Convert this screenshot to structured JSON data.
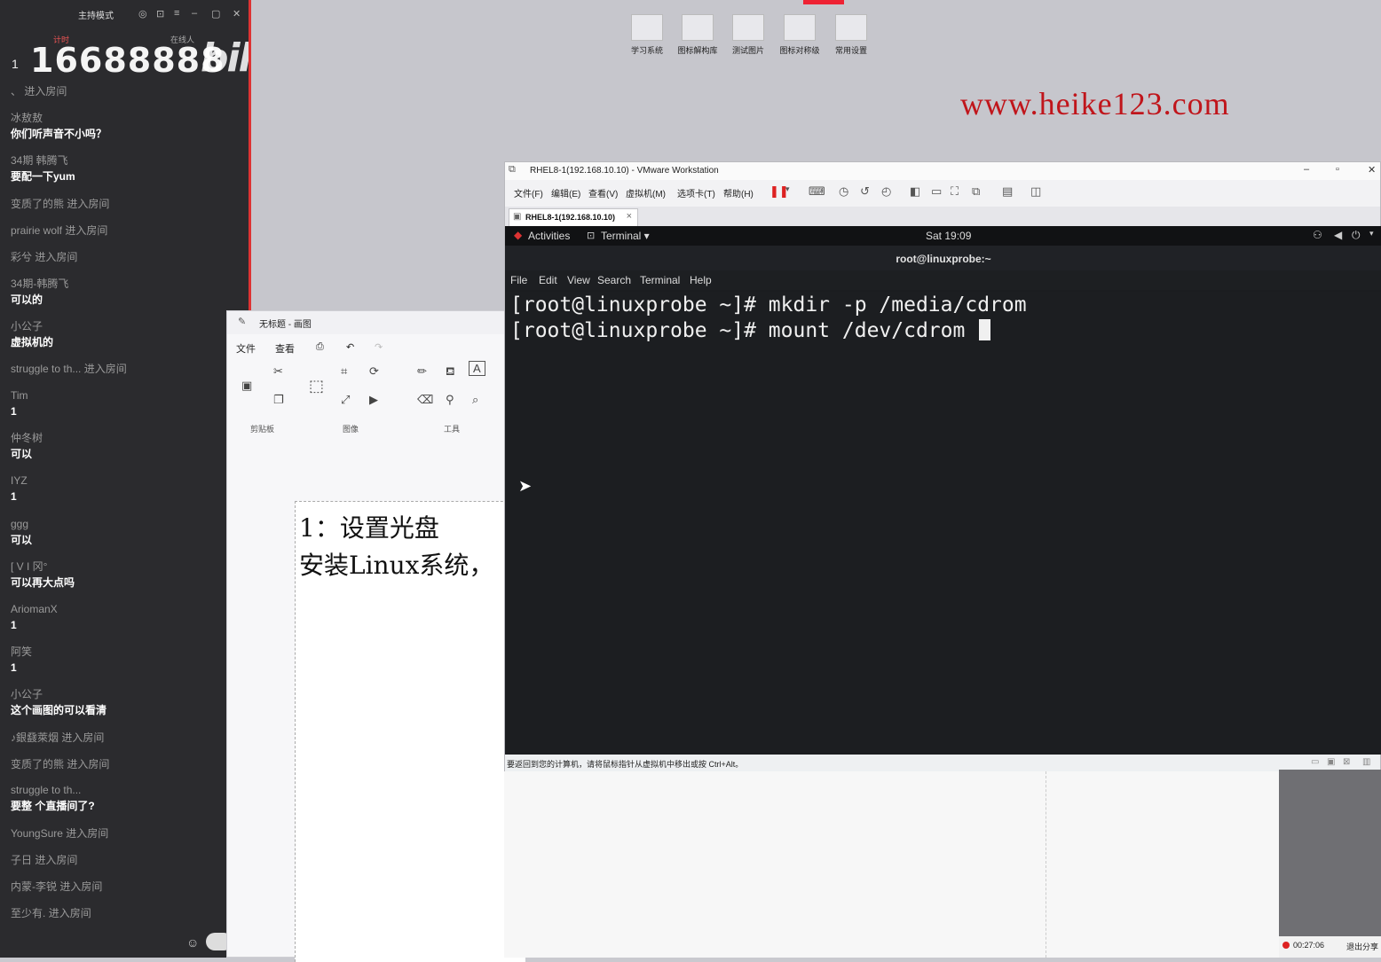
{
  "chat": {
    "mode_label": "主持模式",
    "top_controls": [
      "◎",
      "⊡",
      "≡",
      "–",
      "▢",
      "✕"
    ],
    "head_left": "计时",
    "head_right": "在线人",
    "rank_index": "1",
    "room_number": "16688888",
    "brand": "bilibili",
    "messages": [
      {
        "user": "、",
        "text": "",
        "enter": "进入房间"
      },
      {
        "user": "冰敖敖",
        "text": "你们听声音不小吗？",
        "enter": ""
      },
      {
        "user": "34期 韩腾飞",
        "text": "要配一下yum",
        "enter": ""
      },
      {
        "user": "变质了的熊",
        "text": "",
        "enter": "进入房间"
      },
      {
        "user": "prairie wolf",
        "text": "",
        "enter": "进入房间"
      },
      {
        "user": "彩兮",
        "text": "",
        "enter": "进入房间"
      },
      {
        "user": "34期-韩腾飞",
        "text": "可以的",
        "enter": ""
      },
      {
        "user": "小公子",
        "text": "虚拟机的",
        "enter": ""
      },
      {
        "user": "struggle to th...",
        "text": "",
        "enter": "进入房间"
      },
      {
        "user": "Tim",
        "text": "1",
        "enter": ""
      },
      {
        "user": "仲冬树",
        "text": "可以",
        "enter": ""
      },
      {
        "user": "IYZ",
        "text": "1",
        "enter": ""
      },
      {
        "user": "ggg",
        "text": "可以",
        "enter": ""
      },
      {
        "user": "[ V I 冈°",
        "text": "可以再大点吗",
        "enter": ""
      },
      {
        "user": "AriomanX",
        "text": "1",
        "enter": ""
      },
      {
        "user": "阿笑",
        "text": "1",
        "enter": ""
      },
      {
        "user": "小公子",
        "text": "这个画图的可以看清",
        "enter": ""
      },
      {
        "user": "♪銀鼗萊烟",
        "text": "",
        "enter": "进入房间"
      },
      {
        "user": "变质了的熊",
        "text": "",
        "enter": "进入房间"
      },
      {
        "user": "struggle to th...",
        "text": "要整 个直播间了?",
        "enter": ""
      },
      {
        "user": "YoungSure",
        "text": "",
        "enter": "进入房间"
      },
      {
        "user": "子日",
        "text": "",
        "enter": "进入房间"
      },
      {
        "user": "内蒙-李锐",
        "text": "",
        "enter": "进入房间"
      },
      {
        "user": "至少有.",
        "text": "",
        "enter": "进入房间"
      }
    ],
    "emoji_icon": "☺"
  },
  "desktop": {
    "icons": [
      {
        "label": "学习系统"
      },
      {
        "label": "图标解构库"
      },
      {
        "label": "测试图片"
      },
      {
        "label": "图标对称级"
      },
      {
        "label": "常用设置"
      }
    ],
    "watermark": "www.heike123.com"
  },
  "paint": {
    "title": "无标题 - 画图",
    "menu": {
      "file": "文件",
      "view": "查看"
    },
    "groups": {
      "clipboard": "剪贴板",
      "image": "图像",
      "tools": "工具"
    },
    "canvas_line1": "1：设置光盘",
    "canvas_line2": "安装Linux系统，"
  },
  "vmware": {
    "title": "RHEL8-1(192.168.10.10) - VMware Workstation",
    "menu": [
      "文件(F)",
      "编辑(E)",
      "查看(V)",
      "虚拟机(M)",
      "选项卡(T)",
      "帮助(H)"
    ],
    "tab_label": "RHEL8-1(192.168.10.10)",
    "status_text": "要返回到您的计算机，请将鼠标指针从虚拟机中移出或按 Ctrl+Alt。",
    "guest": {
      "activities": "Activities",
      "app_menu": "Terminal ▾",
      "clock": "Sat 19:09",
      "terminal_title": "root@linuxprobe:~",
      "term_menu": [
        "File",
        "Edit",
        "View",
        "Search",
        "Terminal",
        "Help"
      ],
      "lines": [
        "[root@linuxprobe ~]# mkdir -p /media/cdrom",
        "[root@linuxprobe ~]# mount /dev/cdrom "
      ]
    }
  },
  "recorder": {
    "time": "00:27:06",
    "exit_label": "退出分享"
  }
}
